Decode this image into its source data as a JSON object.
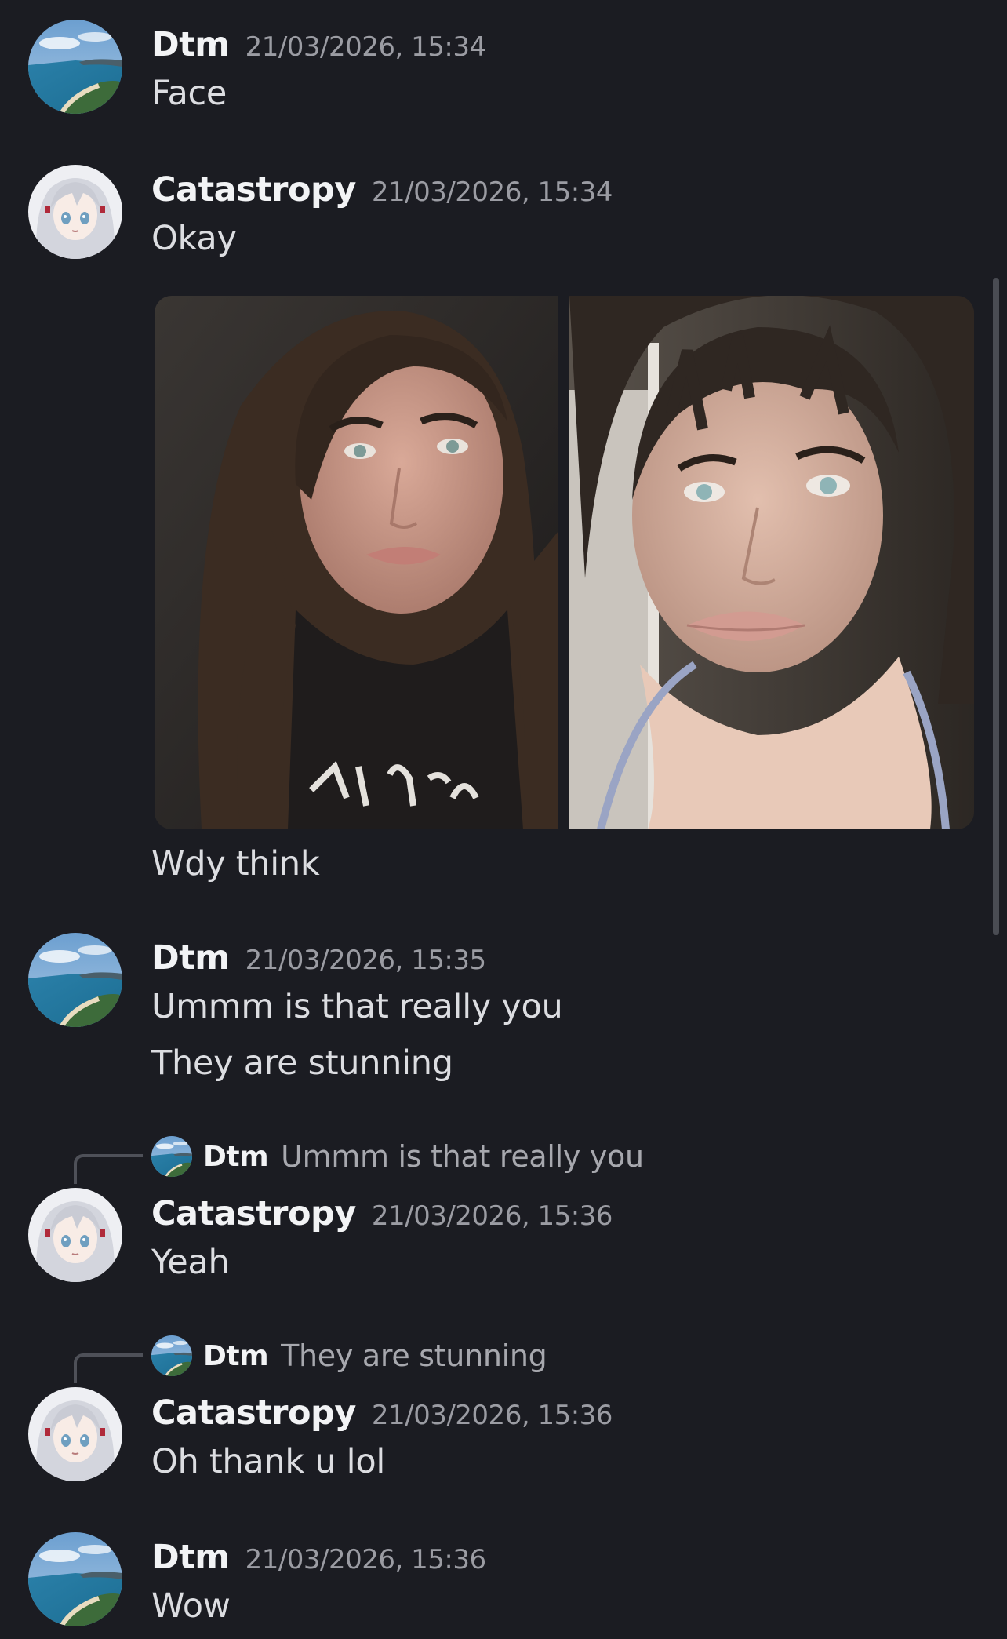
{
  "messages": [
    {
      "author": "Dtm",
      "timestamp": "21/03/2026, 15:34",
      "avatar": "beach-avatar",
      "lines": [
        "Face"
      ]
    },
    {
      "author": "Catastropy",
      "timestamp": "21/03/2026, 15:34",
      "avatar": "anime-girl-avatar",
      "lines": [
        "Okay",
        "Wdy think"
      ],
      "attachments": [
        "photo-selfie-1",
        "photo-selfie-2"
      ]
    },
    {
      "author": "Dtm",
      "timestamp": "21/03/2026, 15:35",
      "avatar": "beach-avatar",
      "lines": [
        "Ummm is that really you",
        "They are stunning"
      ]
    },
    {
      "author": "Catastropy",
      "timestamp": "21/03/2026, 15:36",
      "avatar": "anime-girl-avatar",
      "lines": [
        "Yeah"
      ],
      "reply_to": {
        "author": "Dtm",
        "text": "Ummm is that really you"
      }
    },
    {
      "author": "Catastropy",
      "timestamp": "21/03/2026, 15:36",
      "avatar": "anime-girl-avatar",
      "lines": [
        "Oh thank u lol"
      ],
      "reply_to": {
        "author": "Dtm",
        "text": "They are stunning"
      }
    },
    {
      "author": "Dtm",
      "timestamp": "21/03/2026, 15:36",
      "avatar": "beach-avatar",
      "lines": [
        "Wow"
      ]
    }
  ],
  "colors": {
    "background": "#1b1c22",
    "author": "#f2f3f5",
    "timestamp": "#9b9ca3",
    "text": "#dcdde1",
    "reply_spine": "#4e5058"
  }
}
